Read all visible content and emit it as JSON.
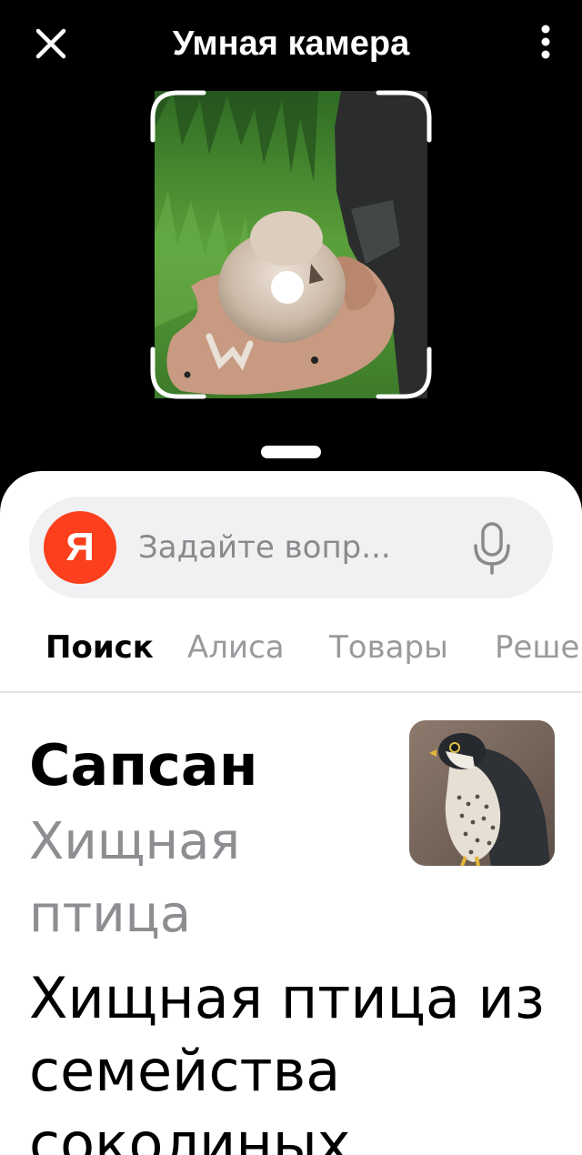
{
  "header": {
    "title": "Умная камера",
    "close_icon": "close-icon",
    "more_icon": "more-vertical-icon"
  },
  "search": {
    "logo_text": "Я",
    "placeholder": "Задайте вопр...",
    "mic_icon": "microphone-icon"
  },
  "tabs": [
    {
      "label": "Поиск",
      "active": true
    },
    {
      "label": "Алиса",
      "active": false
    },
    {
      "label": "Товары",
      "active": false
    },
    {
      "label": "Реше",
      "active": false
    }
  ],
  "result": {
    "title": "Сапсан",
    "subtitle": "Хищная птица",
    "description": "Хищная птица из семейства соколиных."
  },
  "colors": {
    "accent": "#fc3f1d",
    "background": "#000000",
    "sheet": "#ffffff",
    "inactive_tab": "#9a9a9e"
  }
}
